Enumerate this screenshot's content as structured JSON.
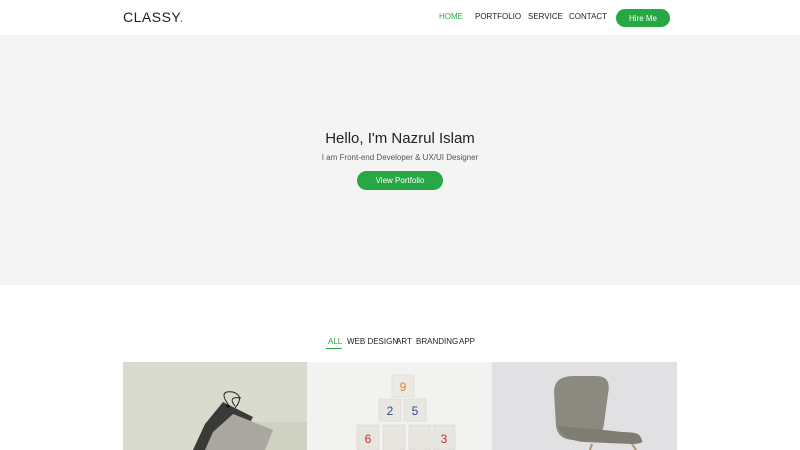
{
  "brand": {
    "name": "CLASSY",
    "dot": "."
  },
  "nav": {
    "items": [
      {
        "label": "HOME",
        "active": true
      },
      {
        "label": "PORTFOLIO",
        "active": false
      },
      {
        "label": "SERVICE",
        "active": false
      },
      {
        "label": "CONTACT",
        "active": false
      }
    ],
    "cta_label": "Hire Me"
  },
  "hero": {
    "title": "Hello, I'm Nazrul Islam",
    "subtitle": "I am Front-end Developer & UX/UI Designer",
    "button_label": "View Portfolio"
  },
  "filters": {
    "items": [
      {
        "label": "ALL",
        "active": true
      },
      {
        "label": "WEB DESIGN",
        "active": false
      },
      {
        "label": "ART",
        "active": false
      },
      {
        "label": "BRANDING",
        "active": false
      },
      {
        "label": "APP",
        "active": false
      }
    ]
  },
  "portfolio": {
    "items": [
      {
        "image": "tags-on-board"
      },
      {
        "image": "numbered-cubes",
        "cube_numbers": [
          "9",
          "2",
          "5",
          "6",
          "3"
        ]
      },
      {
        "image": "chair"
      }
    ]
  },
  "colors": {
    "accent": "#28a745",
    "hero_bg": "#f4f4f4",
    "text": "#222222"
  }
}
